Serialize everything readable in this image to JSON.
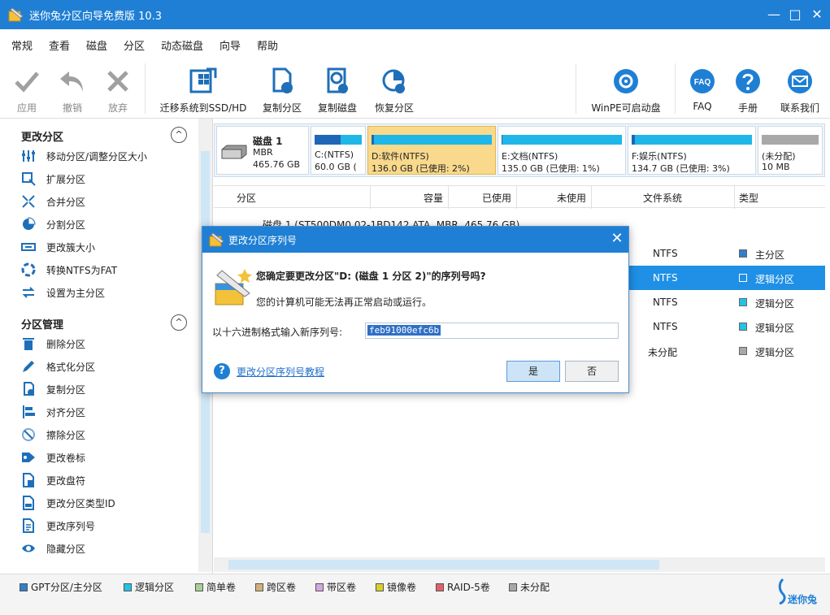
{
  "window": {
    "title": "迷你兔分区向导免费版 10.3",
    "minimize": "—",
    "maximize": "□",
    "close": "✕"
  },
  "menu": [
    "常规",
    "查看",
    "磁盘",
    "分区",
    "动态磁盘",
    "向导",
    "帮助"
  ],
  "toolbar": {
    "apply": "应用",
    "undo": "撤销",
    "discard": "放弃",
    "migrate": "迁移系统到SSD/HD",
    "copy_partition": "复制分区",
    "copy_disk": "复制磁盘",
    "recover": "恢复分区",
    "winpe": "WinPE可启动盘",
    "faq": "FAQ",
    "faq_icon_text": "FAQ",
    "manual": "手册",
    "contact": "联系我们"
  },
  "sidebar": {
    "group1_title": "更改分区",
    "group1": [
      "移动分区/调整分区大小",
      "扩展分区",
      "合并分区",
      "分割分区",
      "更改簇大小",
      "转换NTFS为FAT",
      "设置为主分区"
    ],
    "group2_title": "分区管理",
    "group2": [
      "删除分区",
      "格式化分区",
      "复制分区",
      "对齐分区",
      "擦除分区",
      "更改卷标",
      "更改盘符",
      "更改分区类型ID",
      "更改序列号",
      "隐藏分区"
    ]
  },
  "diskmap": {
    "disk_name": "磁盘 1",
    "disk_type": "MBR",
    "disk_size": "465.76 GB",
    "partitions": [
      {
        "l1": "C:(NTFS)",
        "l2": "60.0 GB (",
        "used": 0.55
      },
      {
        "l1": "D:软件(NTFS)",
        "l2": "136.0 GB (已使用: 2%)",
        "used": 0.02
      },
      {
        "l1": "E:文档(NTFS)",
        "l2": "135.0 GB (已使用: 1%)",
        "used": 0.01
      },
      {
        "l1": "F:娱乐(NTFS)",
        "l2": "134.7 GB (已使用: 3%)",
        "used": 0.03
      },
      {
        "l1": "(未分配)",
        "l2": "10 MB",
        "used": 0
      }
    ]
  },
  "table": {
    "headers": [
      "分区",
      "容量",
      "已使用",
      "未使用",
      "文件系统",
      "类型"
    ],
    "disk_row": "磁盘 1 (ST500DM0 02-1BD142 ATA, MBR, 465.76 GB)",
    "rows": [
      {
        "fs": "NTFS",
        "type": "主分区",
        "color": "#2e7fd0"
      },
      {
        "fs": "NTFS",
        "type": "逻辑分区",
        "color": "#1f90e6"
      },
      {
        "fs": "NTFS",
        "type": "逻辑分区",
        "color": "#22c3e6"
      },
      {
        "fs": "NTFS",
        "type": "逻辑分区",
        "color": "#22c3e6"
      },
      {
        "fs": "未分配",
        "type": "逻辑分区",
        "color": "#a8a8a8"
      }
    ]
  },
  "legend": [
    {
      "label": "GPT分区/主分区",
      "color": "#2e7fd0"
    },
    {
      "label": "逻辑分区",
      "color": "#22c3e6"
    },
    {
      "label": "简单卷",
      "color": "#a9cf94"
    },
    {
      "label": "跨区卷",
      "color": "#d3b07a"
    },
    {
      "label": "带区卷",
      "color": "#d6a6e2"
    },
    {
      "label": "镜像卷",
      "color": "#d8d02a"
    },
    {
      "label": "RAID-5卷",
      "color": "#e2606a"
    },
    {
      "label": "未分配",
      "color": "#a8a8a8"
    }
  ],
  "brand": "迷你兔",
  "dialog": {
    "title": "更改分区序列号",
    "question": "您确定要更改分区\"D: (磁盘 1 分区 2)\"的序列号吗?",
    "warning": "您的计算机可能无法再正常启动或运行。",
    "input_label": "以十六进制格式输入新序列号:",
    "input_value": "feb91000efc6b",
    "help_icon": "?",
    "help_link": "更改分区序列号教程",
    "yes": "是",
    "no": "否"
  }
}
